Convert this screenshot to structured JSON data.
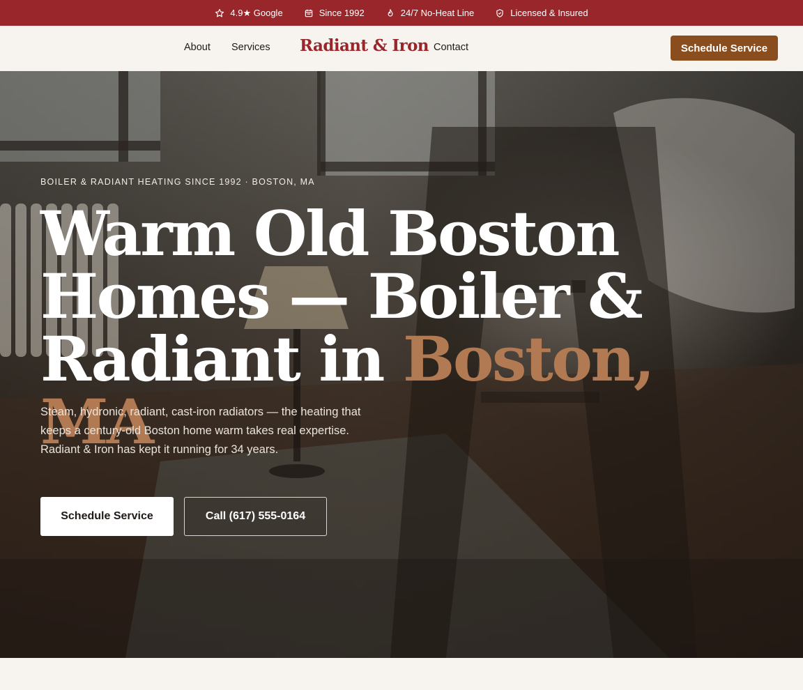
{
  "topbar": {
    "items": [
      {
        "icon": "star-icon",
        "label": "4.9★ Google"
      },
      {
        "icon": "calendar-icon",
        "label": "Since 1992"
      },
      {
        "icon": "flame-icon",
        "label": "24/7 No-Heat Line"
      },
      {
        "icon": "shield-icon",
        "label": "Licensed & Insured"
      }
    ]
  },
  "nav": {
    "about": "About",
    "services": "Services",
    "logo": "Radiant & Iron",
    "contact": "Contact",
    "cta": "Schedule Service"
  },
  "hero": {
    "eyebrow": "BOILER & RADIANT HEATING SINCE 1992 · BOSTON, MA",
    "headline_main": "Warm Old Boston Homes — Boiler & Radiant in ",
    "headline_accent": "Boston, MA",
    "subtext": "Steam, hydronic, radiant, cast-iron radiators — the heating that keeps a century-old Boston home warm takes real expertise. Radiant & Iron has kept it running for 34 years.",
    "primary_button": "Schedule Service",
    "secondary_button": "Call (617) 555-0164"
  },
  "colors": {
    "brand_red": "#98262a",
    "cta_brown": "#8a4e1e",
    "accent_copper": "#b27a52",
    "background_cream": "#f7f3ee"
  }
}
